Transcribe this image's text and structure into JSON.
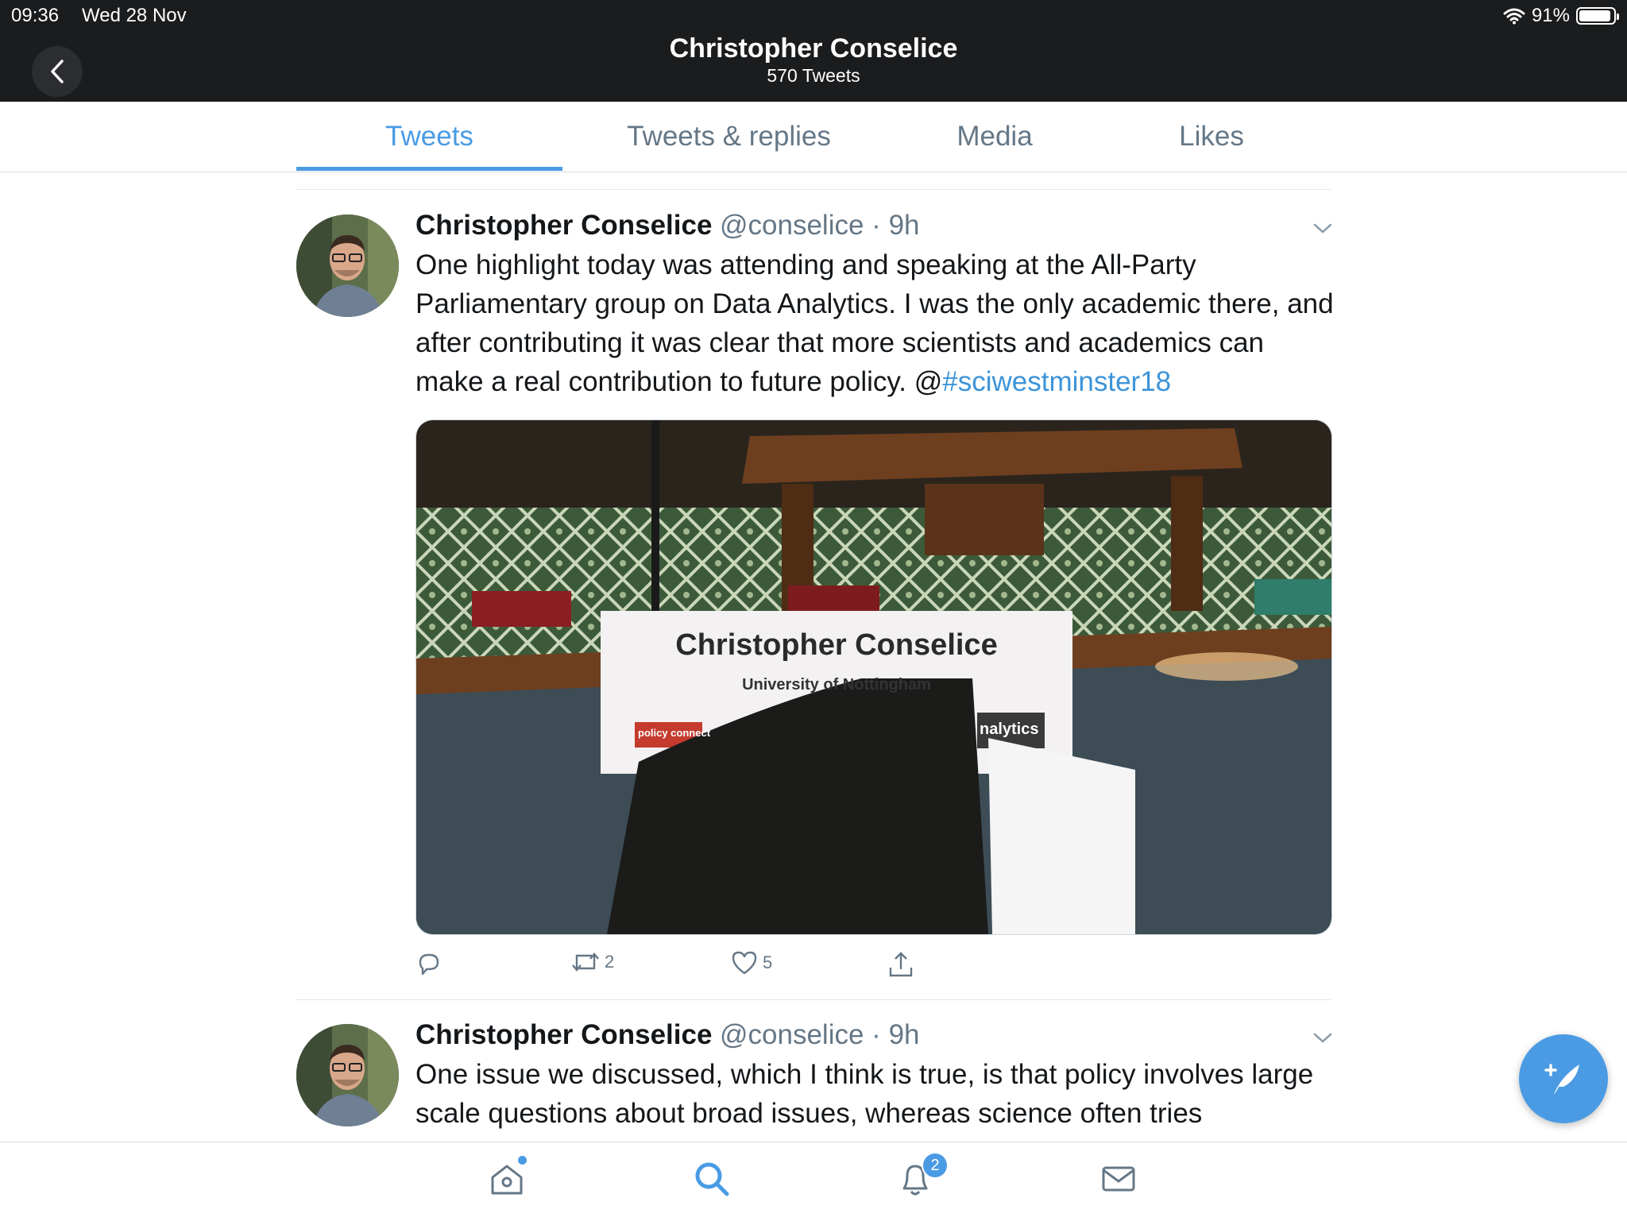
{
  "status": {
    "time": "09:36",
    "date": "Wed 28 Nov",
    "battery": "91%"
  },
  "header": {
    "title": "Christopher Conselice",
    "subtitle": "570 Tweets"
  },
  "tabs": [
    {
      "label": "Tweets",
      "active": true
    },
    {
      "label": "Tweets & replies",
      "active": false
    },
    {
      "label": "Media",
      "active": false
    },
    {
      "label": "Likes",
      "active": false
    }
  ],
  "tweets": [
    {
      "name": "Christopher Conselice",
      "handle": "@conselice",
      "time": "9h",
      "text_main": "One highlight today was attending and speaking at the All-Party Parliamentary group on Data Analytics.  I was the only academic there, and after contributing it was clear that more scientists and academics can make a real contribution to future policy.  @",
      "hashtag": "#sciwestminster18",
      "media": {
        "nameplate_name": "Christopher Conselice",
        "nameplate_org": "University of Nottingham",
        "logo_left": "policy connect",
        "logo_right": "nalytics"
      },
      "retweets": "2",
      "likes": "5"
    },
    {
      "name": "Christopher Conselice",
      "handle": "@conselice",
      "time": "9h",
      "text_main": "One issue we discussed, which I think is true, is that policy involves large scale questions about broad issues, whereas science often tries"
    }
  ],
  "bottom_nav": {
    "notifications_badge": "2"
  },
  "colors": {
    "accent": "#4a9be4",
    "header_bg": "#1b1c1e",
    "muted": "#657786"
  }
}
